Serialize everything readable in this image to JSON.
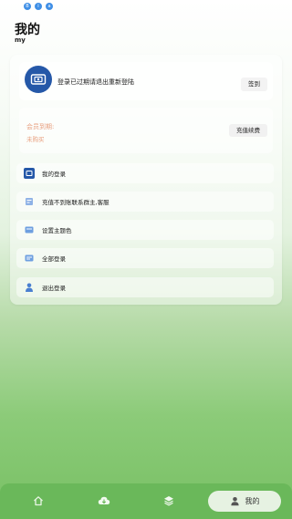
{
  "status_bar": {
    "dots": [
      "B",
      "i",
      "a"
    ]
  },
  "header": {
    "title": "我的",
    "subtitle": "my"
  },
  "login": {
    "text": "登录已过期请退出重新登陆",
    "signin_label": "签到"
  },
  "membership": {
    "title": "会员到期:",
    "status": "未购买",
    "recharge_label": "充值续费"
  },
  "menu": [
    {
      "label": "我的登录",
      "icon": "ticket-icon"
    },
    {
      "label": "充值不到账联系群主,客服",
      "icon": "support-icon"
    },
    {
      "label": "设置主题色",
      "icon": "palette-icon"
    },
    {
      "label": "全部登录",
      "icon": "list-icon"
    },
    {
      "label": "退出登录",
      "icon": "user-icon"
    }
  ],
  "bottom_nav": {
    "items": [
      {
        "name": "home",
        "icon": "home-icon"
      },
      {
        "name": "download",
        "icon": "cloud-download-icon"
      },
      {
        "name": "layers",
        "icon": "layers-icon"
      }
    ],
    "active_label": "我的",
    "active_icon": "person-icon"
  },
  "colors": {
    "accent_green": "#6ab85a",
    "member_text": "#e8a080",
    "icon_blue": "#2558a8"
  }
}
